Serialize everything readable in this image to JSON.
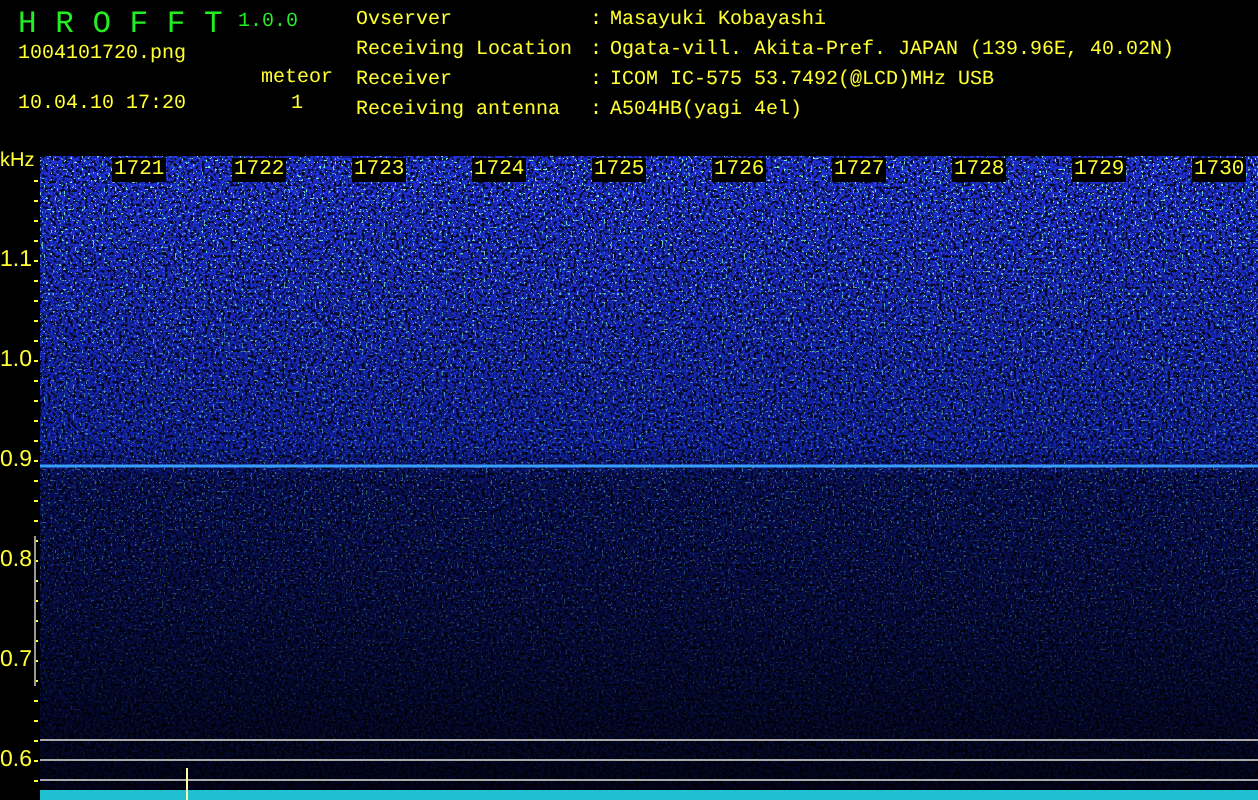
{
  "app": {
    "title": "H R O F F T",
    "version": "1.0.0",
    "file": "1004101720.png",
    "datetime": "10.04.10 17:20",
    "meteor_label": "meteor",
    "meteor_count": "1"
  },
  "info": [
    {
      "label": "Ovserver",
      "value": "Masayuki Kobayashi"
    },
    {
      "label": "Receiving Location",
      "value": "Ogata-vill. Akita-Pref. JAPAN (139.96E, 40.02N)"
    },
    {
      "label": "Receiver",
      "value": "ICOM IC-575 53.7492(@LCD)MHz USB"
    },
    {
      "label": "Receiving antenna",
      "value": "A504HB(yagi 4el)"
    }
  ],
  "separator": ":",
  "spectrogram": {
    "y_unit": "kHz",
    "y_labels": [
      "1.1",
      "1.0",
      "0.9",
      "0.8",
      "0.7",
      "0.6"
    ],
    "x_labels": [
      "1721",
      "1722",
      "1723",
      "1724",
      "1725",
      "1726",
      "1727",
      "1728",
      "1729",
      "1730"
    ]
  }
}
